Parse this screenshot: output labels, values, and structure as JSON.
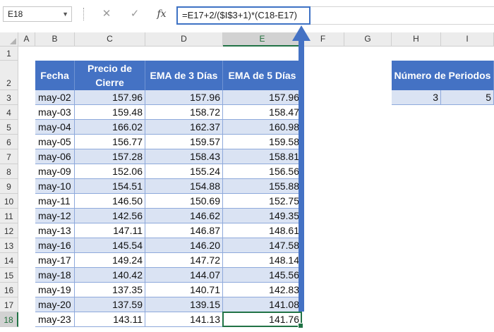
{
  "formula_bar": {
    "name_box": "E18",
    "cancel_icon": "✕",
    "enter_icon": "✓",
    "fx_label": "fx",
    "formula": "=E17+2/($I$3+1)*(C18-E17)"
  },
  "columns": [
    "A",
    "B",
    "C",
    "D",
    "E",
    "F",
    "G",
    "H",
    "I"
  ],
  "rows": [
    "1",
    "2",
    "3",
    "4",
    "5",
    "6",
    "7",
    "8",
    "9",
    "10",
    "11",
    "12",
    "13",
    "14",
    "15",
    "16",
    "17",
    "18"
  ],
  "active_cell": {
    "column": "E",
    "row": "18"
  },
  "table": {
    "headers": [
      "Fecha",
      "Precio de Cierre",
      "EMA de 3 Días",
      "EMA de 5 Días"
    ],
    "rows": [
      [
        "may-02",
        "157.96",
        "157.96",
        "157.96"
      ],
      [
        "may-03",
        "159.48",
        "158.72",
        "158.47"
      ],
      [
        "may-04",
        "166.02",
        "162.37",
        "160.98"
      ],
      [
        "may-05",
        "156.77",
        "159.57",
        "159.58"
      ],
      [
        "may-06",
        "157.28",
        "158.43",
        "158.81"
      ],
      [
        "may-09",
        "152.06",
        "155.24",
        "156.56"
      ],
      [
        "may-10",
        "154.51",
        "154.88",
        "155.88"
      ],
      [
        "may-11",
        "146.50",
        "150.69",
        "152.75"
      ],
      [
        "may-12",
        "142.56",
        "146.62",
        "149.35"
      ],
      [
        "may-13",
        "147.11",
        "146.87",
        "148.61"
      ],
      [
        "may-16",
        "145.54",
        "146.20",
        "147.58"
      ],
      [
        "may-17",
        "149.24",
        "147.72",
        "148.14"
      ],
      [
        "may-18",
        "140.42",
        "144.07",
        "145.56"
      ],
      [
        "may-19",
        "137.35",
        "140.71",
        "142.83"
      ],
      [
        "may-20",
        "137.59",
        "139.15",
        "141.08"
      ],
      [
        "may-23",
        "143.11",
        "141.13",
        "141.76"
      ]
    ]
  },
  "periods": {
    "header": "Número de Periodos",
    "values": [
      "3",
      "5"
    ]
  },
  "colors": {
    "header_bg": "#4472c4",
    "band_bg": "#dae3f3",
    "selection": "#217346",
    "arrow": "#4472c4"
  }
}
